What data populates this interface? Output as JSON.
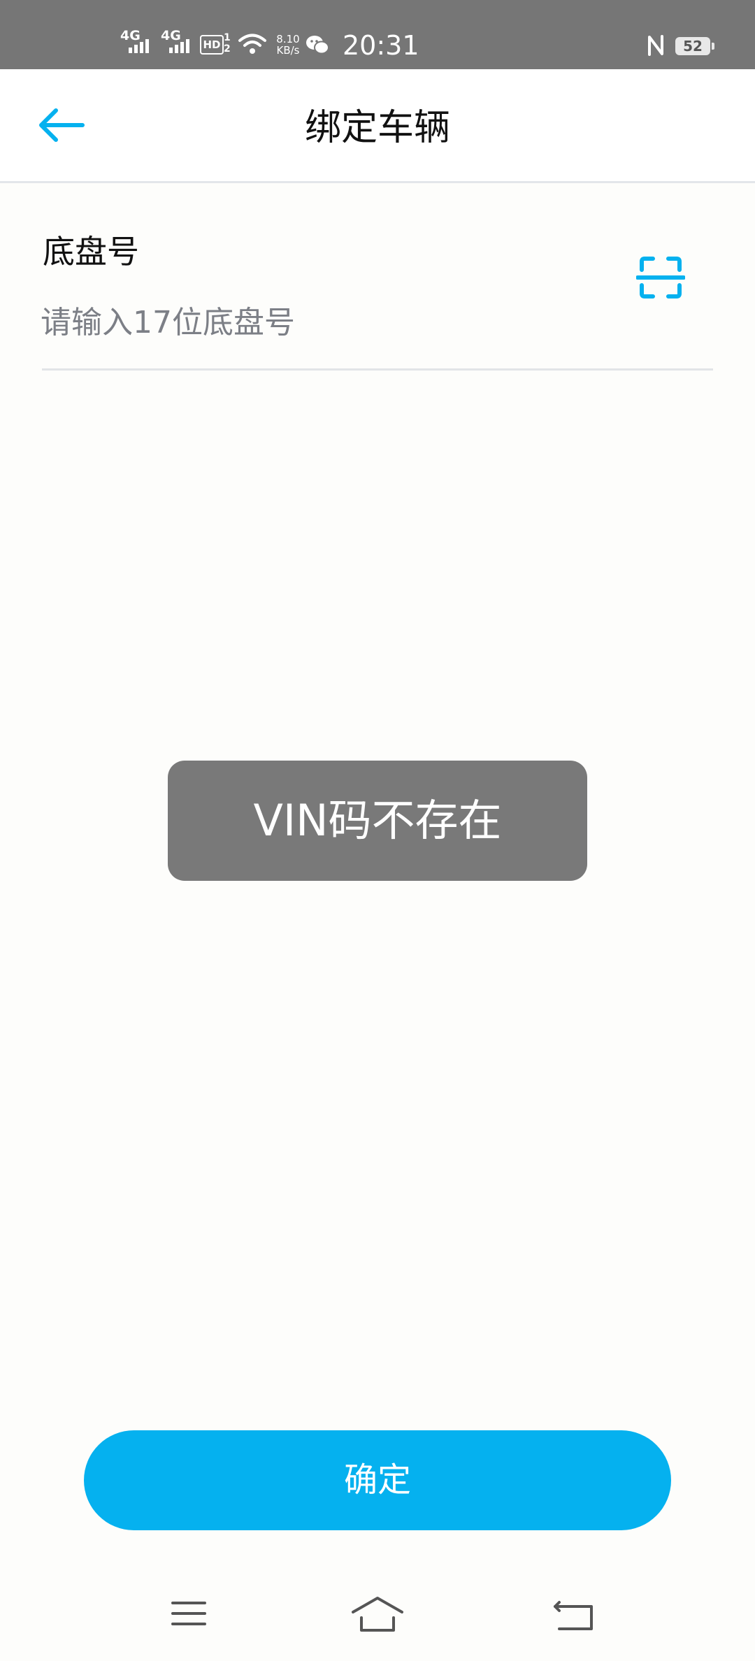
{
  "status_bar": {
    "network_1": "4G",
    "network_2": "4G",
    "hd_label": "HD",
    "hd_sup": "1",
    "hd_sub": "2",
    "speed_value": "8.10",
    "speed_unit": "KB/s",
    "time": "20:31",
    "battery": "52"
  },
  "header": {
    "title": "绑定车辆",
    "back_icon": "arrow-left-icon"
  },
  "form": {
    "label": "底盘号",
    "placeholder": "请输入17位底盘号",
    "value": "",
    "scan_icon": "scan-frame-icon"
  },
  "toast": {
    "message": "VIN码不存在"
  },
  "actions": {
    "confirm_label": "确定"
  },
  "nav": {
    "icons": [
      "menu-icon",
      "home-icon",
      "back-icon"
    ]
  },
  "colors": {
    "accent": "#05b1ef",
    "status_bar": "#767676",
    "toast_bg": "#797979",
    "page_bg": "#fdfdfb"
  }
}
